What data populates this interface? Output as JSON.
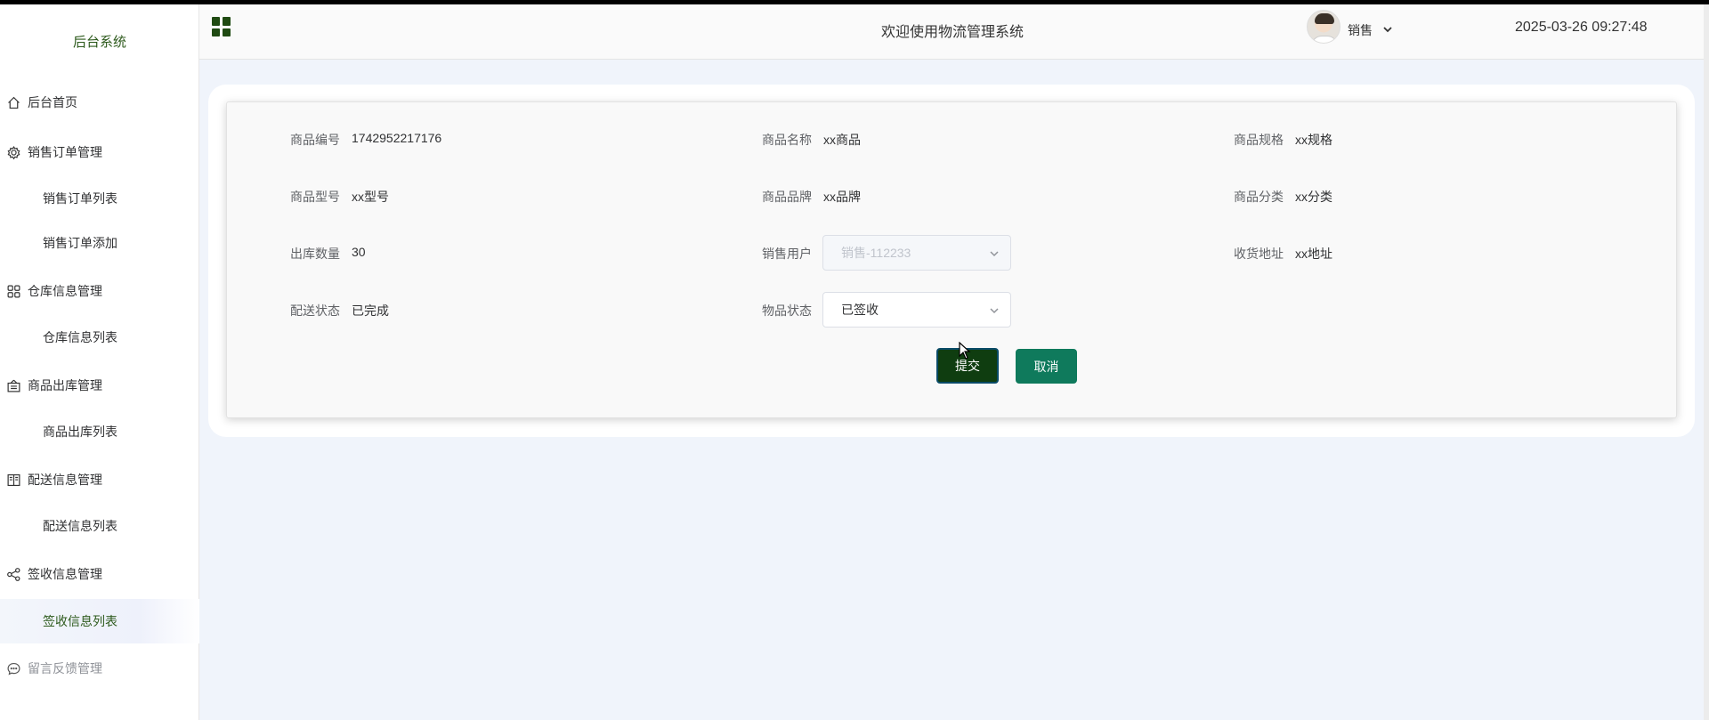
{
  "sidebar": {
    "brand": "后台系统",
    "items": [
      {
        "label": "后台首页",
        "icon": "home-icon"
      },
      {
        "label": "销售订单管理",
        "icon": "gear-icon"
      },
      {
        "label": "销售订单列表"
      },
      {
        "label": "销售订单添加"
      },
      {
        "label": "仓库信息管理",
        "icon": "grid-icon"
      },
      {
        "label": "仓库信息列表"
      },
      {
        "label": "商品出库管理",
        "icon": "box-icon"
      },
      {
        "label": "商品出库列表"
      },
      {
        "label": "配送信息管理",
        "icon": "book-icon"
      },
      {
        "label": "配送信息列表"
      },
      {
        "label": "签收信息管理",
        "icon": "share-icon"
      },
      {
        "label": "签收信息列表"
      },
      {
        "label": "留言反馈管理",
        "icon": "chat-icon"
      }
    ],
    "active_item": "签收信息列表"
  },
  "header": {
    "title": "欢迎使用物流管理系统",
    "user": "销售",
    "datetime": "2025-03-26 09:27:48"
  },
  "form": {
    "fields": [
      {
        "label": "商品编号",
        "value": "1742952217176"
      },
      {
        "label": "商品名称",
        "value": "xx商品"
      },
      {
        "label": "商品规格",
        "value": "xx规格"
      },
      {
        "label": "商品型号",
        "value": "xx型号"
      },
      {
        "label": "商品品牌",
        "value": "xx品牌"
      },
      {
        "label": "商品分类",
        "value": "xx分类"
      },
      {
        "label": "出库数量",
        "value": "30"
      },
      {
        "label": "销售用户",
        "value": "销售-112233"
      },
      {
        "label": "收货地址",
        "value": "xx地址"
      },
      {
        "label": "配送状态",
        "value": "已完成"
      },
      {
        "label": "物品状态",
        "value": "已签收"
      }
    ],
    "submit_label": "提交",
    "cancel_label": "取消"
  },
  "colors": {
    "accent": "#0f3d10",
    "cancel": "#0f7a5c",
    "brand_text": "#2d5a1c",
    "background": "#f0f4fb"
  }
}
